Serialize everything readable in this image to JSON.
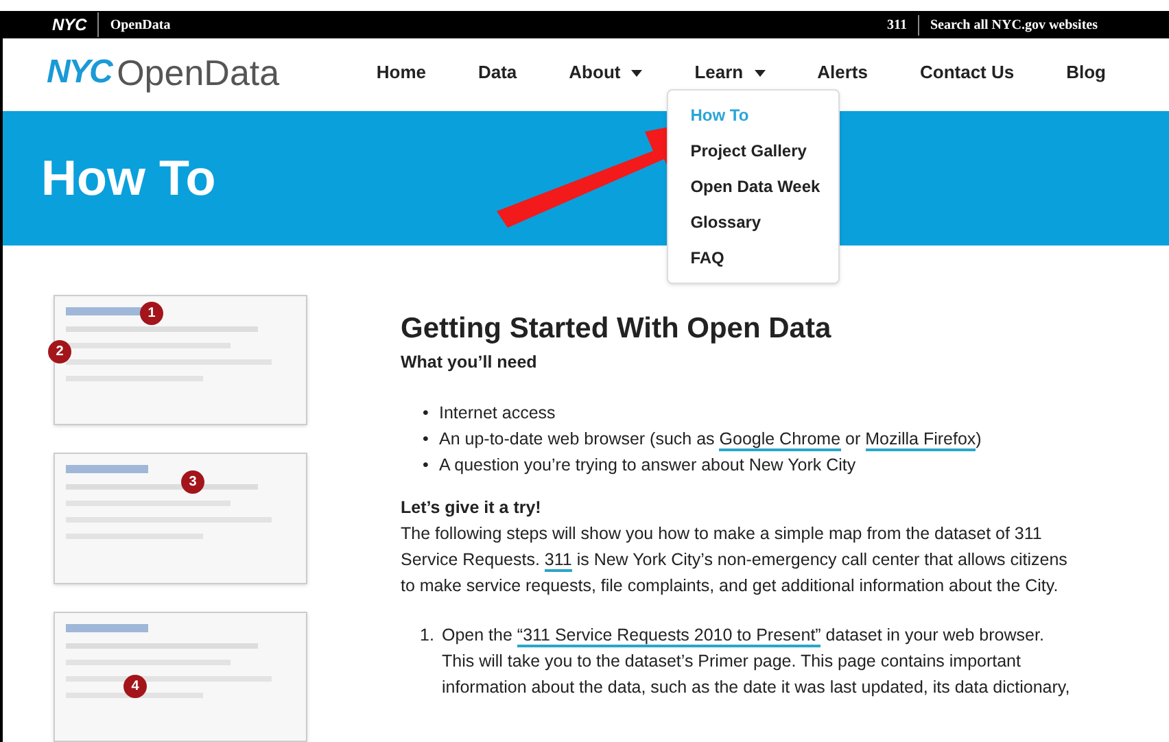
{
  "top_bar": {
    "logo": "NYC",
    "site": "OpenData",
    "links": [
      "311",
      "Search all NYC.gov websites"
    ]
  },
  "header": {
    "logo_mark": "NYC",
    "logo_text": "OpenData",
    "nav": [
      {
        "label": "Home",
        "dropdown": false
      },
      {
        "label": "Data",
        "dropdown": false
      },
      {
        "label": "About",
        "dropdown": true
      },
      {
        "label": "Learn",
        "dropdown": true,
        "menu": [
          {
            "label": "How To",
            "selected": true
          },
          {
            "label": "Project Gallery",
            "selected": false
          },
          {
            "label": "Open Data Week",
            "selected": false
          },
          {
            "label": "Glossary",
            "selected": false
          },
          {
            "label": "FAQ",
            "selected": false
          }
        ]
      },
      {
        "label": "Alerts",
        "dropdown": false
      },
      {
        "label": "Contact Us",
        "dropdown": false
      },
      {
        "label": "Blog",
        "dropdown": false
      }
    ]
  },
  "banner": {
    "title": "How To"
  },
  "thumbnails": [
    {
      "badges": [
        "1",
        "2"
      ]
    },
    {
      "badges": [
        "3"
      ]
    },
    {
      "badges": [
        "4"
      ]
    }
  ],
  "article": {
    "title": "Getting Started With Open Data",
    "subtitle": "What you’ll need",
    "bullets": [
      {
        "marker": "•",
        "parts": [
          {
            "text": "Internet access",
            "kind": "text"
          }
        ]
      },
      {
        "marker": "•",
        "parts": [
          {
            "text": "An up-to-date web browser (such as ",
            "kind": "text"
          },
          {
            "text": "Google Chrome",
            "kind": "link"
          },
          {
            "text": " or ",
            "kind": "text"
          },
          {
            "text": "Mozilla Firefox",
            "kind": "link"
          },
          {
            "text": ")",
            "kind": "text"
          }
        ]
      },
      {
        "marker": "•",
        "parts": [
          {
            "text": "A question you’re trying to answer about New York City",
            "kind": "text"
          }
        ]
      }
    ],
    "try_heading": "Let’s give it a try!",
    "paragraph": [
      {
        "text": "The following steps will show you how to make a simple map from the dataset of 311 Service Requests. ",
        "kind": "text"
      },
      {
        "text": "311",
        "kind": "link"
      },
      {
        "text": " is New York City’s non-emergency call center that allows citizens to make service requests, file complaints, and get additional information about the City.",
        "kind": "text"
      }
    ],
    "steps": [
      {
        "marker": "1.",
        "parts": [
          {
            "text": "Open the ",
            "kind": "text"
          },
          {
            "text": "“311 Service Requests 2010 to Present”",
            "kind": "link"
          },
          {
            "text": " dataset in your web browser. This will take you to the dataset’s Primer page. This page contains important information about the data, such as the date it was last updated, its data dictionary,",
            "kind": "text"
          }
        ]
      }
    ]
  }
}
